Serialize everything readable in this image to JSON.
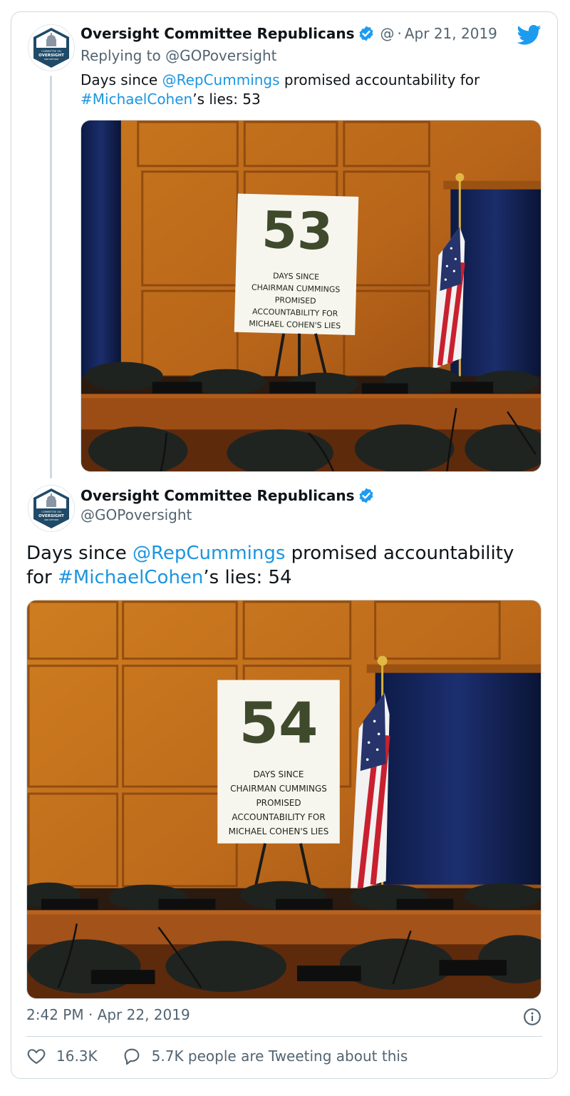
{
  "reply_tweet": {
    "author_name": "Oversight Committee Republicans",
    "handle_short": "@",
    "separator": "·",
    "date": "Apr 21, 2019",
    "replying_to_label": "Replying to @GOPoversight",
    "text_before": "Days since ",
    "mention": "@RepCummings",
    "text_middle": " promised accountability for ",
    "hashtag": "#MichaelCohen",
    "text_after": "’s lies: 53",
    "photo_sign": {
      "number": "53",
      "lines": [
        "DAYS SINCE",
        "CHAIRMAN CUMMINGS",
        "PROMISED",
        "ACCOUNTABILITY FOR",
        "MICHAEL COHEN'S LIES"
      ]
    },
    "avatar_text": [
      "COMMITTEE ON",
      "OVERSIGHT",
      "AND REFORM"
    ]
  },
  "main_tweet": {
    "author_name": "Oversight Committee Republicans",
    "handle": "@GOPoversight",
    "text_before": "Days since ",
    "mention": "@RepCummings",
    "text_middle": " promised accountability for ",
    "hashtag": "#MichaelCohen",
    "text_after": "’s lies: 54",
    "photo_sign": {
      "number": "54",
      "lines": [
        "DAYS SINCE",
        "CHAIRMAN CUMMINGS",
        "PROMISED",
        "ACCOUNTABILITY FOR",
        "MICHAEL COHEN'S LIES"
      ]
    },
    "timestamp": "2:42 PM · Apr 22, 2019",
    "likes": "16.3K",
    "tweeting_about": "5.7K people are Tweeting about this"
  },
  "colors": {
    "link": "#1b95e0",
    "verified": "#1d9bf0",
    "muted": "#536471",
    "border": "#cfd9de"
  },
  "icons": [
    "verified-badge-icon",
    "twitter-bird-icon",
    "info-icon",
    "heart-icon",
    "reply-bubble-icon"
  ]
}
